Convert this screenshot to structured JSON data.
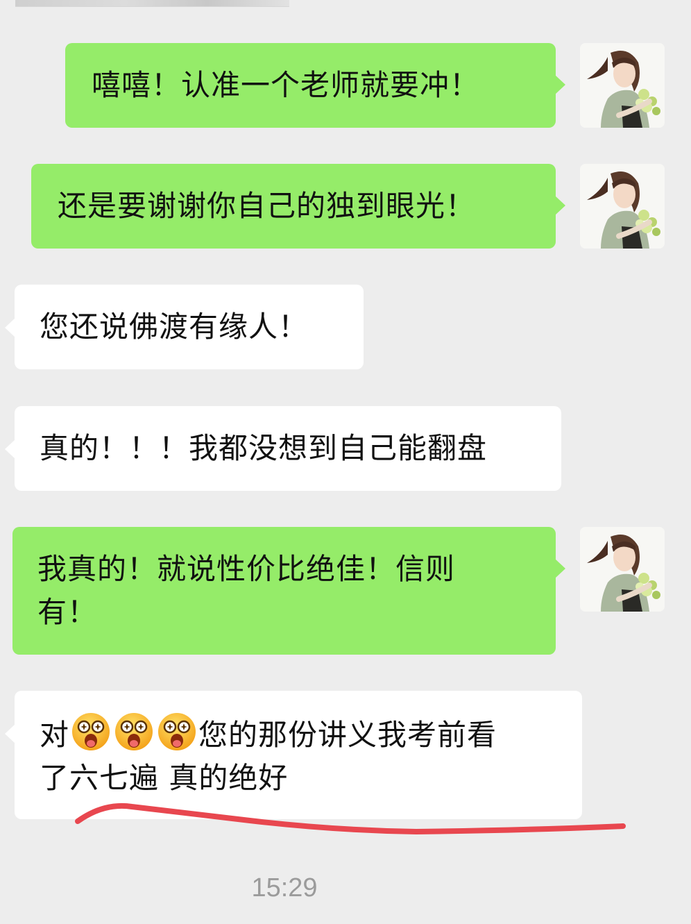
{
  "chat": {
    "messages": [
      {
        "direction": "sent",
        "text": "嘻嘻！认准一个老师就要冲！"
      },
      {
        "direction": "sent",
        "text": "还是要谢谢你自己的独到眼光！"
      },
      {
        "direction": "received",
        "text": "您还说佛渡有缘人！"
      },
      {
        "direction": "received",
        "text": "真的！！！我都没想到自己能翻盘"
      },
      {
        "direction": "sent",
        "text": "我真的！就说性价比绝佳！信则\n有！"
      },
      {
        "direction": "received",
        "text_prefix": "对",
        "emoji": [
          "excited-face-emoji",
          "excited-face-emoji",
          "excited-face-emoji"
        ],
        "text_suffix": "您的那份讲义我考前看\n了六七遍 真的绝好"
      }
    ],
    "timestamp": "15:29",
    "annotation_color": "#e8474f",
    "bubble_colors": {
      "sent": "#95ec69",
      "received": "#ffffff"
    }
  }
}
